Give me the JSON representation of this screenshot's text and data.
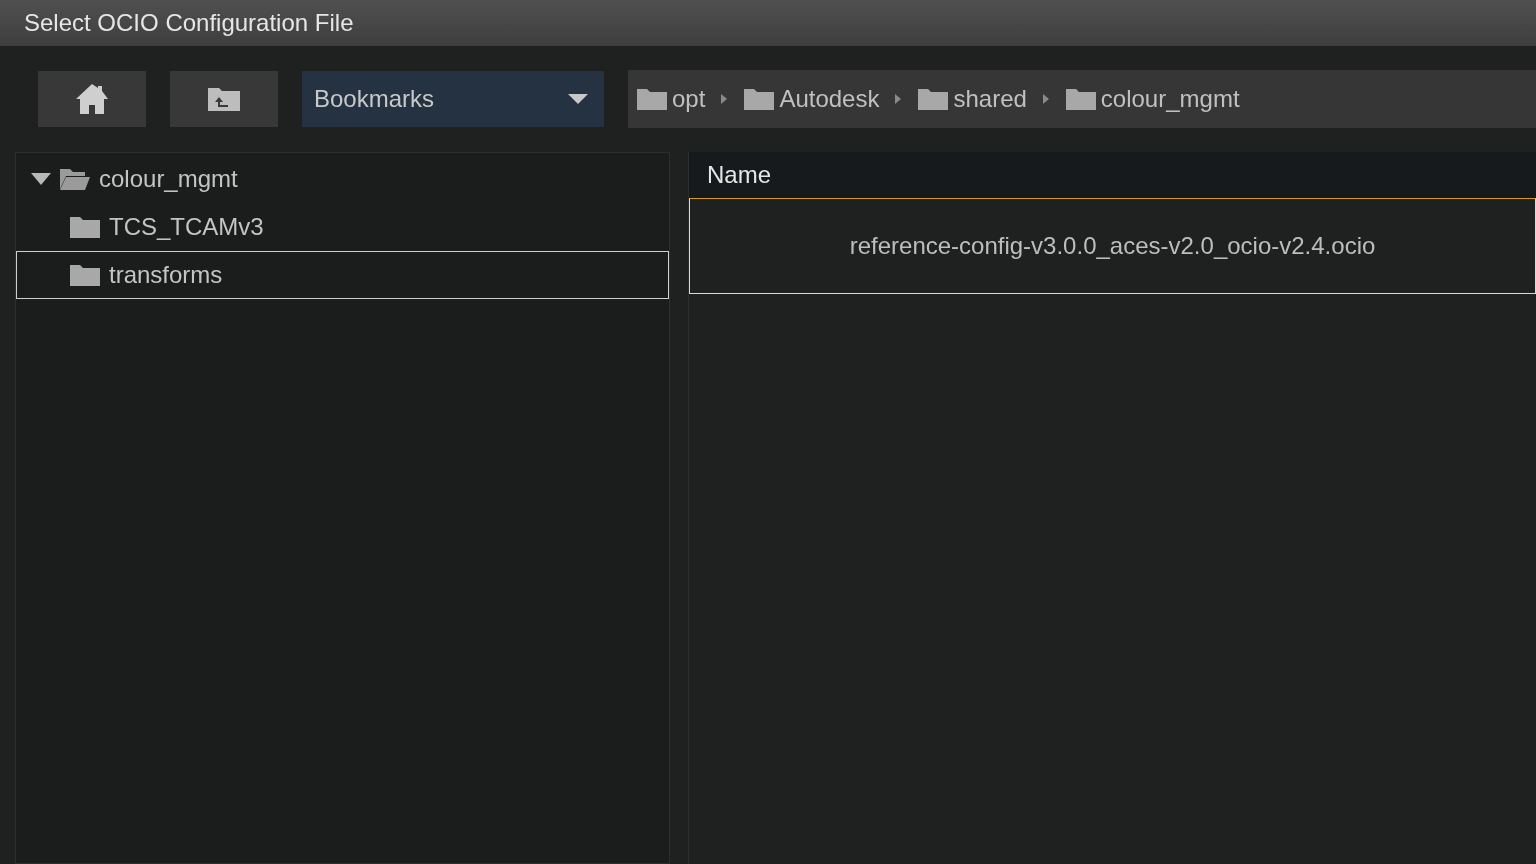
{
  "window": {
    "title": "Select OCIO Configuration File"
  },
  "toolbar": {
    "bookmarks": {
      "label": "Bookmarks"
    }
  },
  "breadcrumb": [
    {
      "label": "opt"
    },
    {
      "label": "Autodesk"
    },
    {
      "label": "shared"
    },
    {
      "label": "colour_mgmt"
    }
  ],
  "tree": [
    {
      "label": "colour_mgmt",
      "expanded": true,
      "selected": false,
      "children": [
        {
          "label": "TCS_TCAMv3",
          "selected": false
        },
        {
          "label": "transforms",
          "selected": true
        }
      ]
    }
  ],
  "files": {
    "columns": [
      "Name"
    ],
    "rows": [
      {
        "name": "reference-config-v3.0.0_aces-v2.0_ocio-v2.4.ocio",
        "selected": true
      }
    ]
  }
}
